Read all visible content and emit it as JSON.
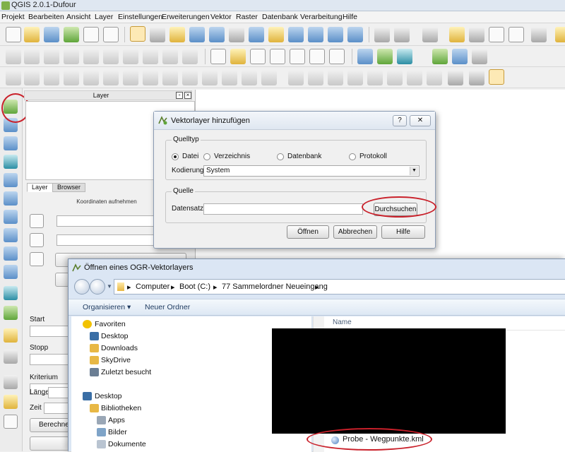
{
  "app": {
    "title": "QGIS 2.0.1-Dufour"
  },
  "menu": [
    "Projekt",
    "Bearbeiten",
    "Ansicht",
    "Layer",
    "Einstellungen",
    "Erweiterungen",
    "Vektor",
    "Raster",
    "Datenbank",
    "Verarbeitung",
    "Hilfe"
  ],
  "layer_panel": {
    "title": "Layer",
    "tabs": [
      "Layer",
      "Browser"
    ],
    "coord_header": "Koordinaten aufnehmen",
    "labels": {
      "start": "Start",
      "stopp": "Stopp",
      "kriterium": "Kriterium",
      "laenge": "Länge",
      "zeit": "Zeit"
    },
    "calc_button": "Berechnen"
  },
  "vector_dialog": {
    "title": "Vektorlayer hinzufügen",
    "help_glyph": "?",
    "close_glyph": "✕",
    "source_type": {
      "label": "Quelltyp",
      "options": [
        "Datei",
        "Verzeichnis",
        "Datenbank",
        "Protokoll"
      ],
      "selected": "Datei"
    },
    "encoding": {
      "label": "Kodierung",
      "value": "System"
    },
    "source": {
      "label": "Quelle",
      "dataset_label": "Datensatz",
      "dataset_value": "",
      "browse_button": "Durchsuchen"
    },
    "buttons": {
      "open": "Öffnen",
      "cancel": "Abbrechen",
      "help": "Hilfe"
    }
  },
  "file_dialog": {
    "title": "Öffnen eines OGR-Vektorlayers",
    "breadcrumb": [
      "Computer",
      "Boot (C:)",
      "77 Sammelordner Neueingang"
    ],
    "commands": {
      "organize": "Organisieren ▾",
      "new_folder": "Neuer Ordner"
    },
    "nav": {
      "favorites_label": "Favoriten",
      "favorites": [
        "Desktop",
        "Downloads",
        "SkyDrive",
        "Zuletzt besucht"
      ],
      "desktop_label": "Desktop",
      "libraries_label": "Bibliotheken",
      "libraries": [
        "Apps",
        "Bilder",
        "Dokumente"
      ]
    },
    "columns": {
      "name": "Name"
    },
    "file": "Probe - Wegpunkte.kml"
  }
}
